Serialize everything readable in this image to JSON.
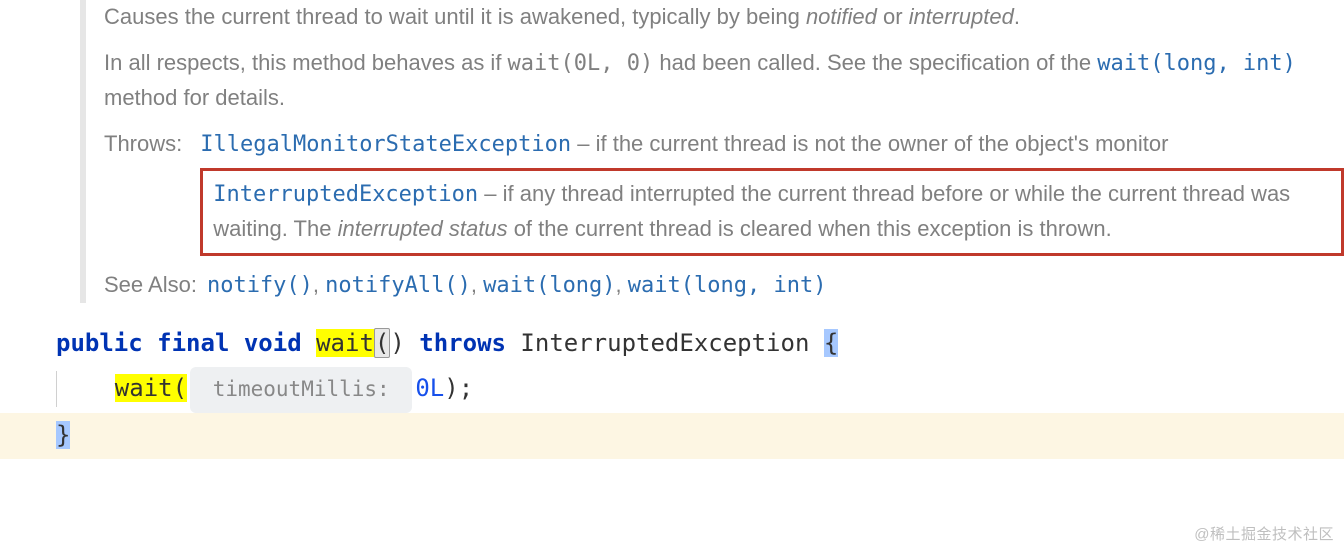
{
  "doc": {
    "para1_prefix": "Causes the current thread to wait until it is awakened, typically by being ",
    "para1_ital1": "notified",
    "para1_mid": " or ",
    "para1_ital2": "interrupted",
    "para1_suffix": ".",
    "para2_prefix": "In all respects, this method behaves as if ",
    "para2_code": "wait(0L, 0)",
    "para2_mid": " had been called. See the specification of the ",
    "para2_link": "wait(long, int)",
    "para2_suffix": " method for details.",
    "throws_label": "Throws:",
    "throws": [
      {
        "exc": "IllegalMonitorStateException",
        "dash": " – ",
        "desc": "if the current thread is not the owner of the object's monitor"
      },
      {
        "exc": "InterruptedException",
        "dash": " – ",
        "desc_prefix": "if any thread interrupted the current thread before or while the current thread was waiting. The ",
        "desc_ital": "interrupted status",
        "desc_suffix": " of the current thread is cleared when this exception is thrown."
      }
    ],
    "seealso_label": "See Also:",
    "seealso": [
      "notify()",
      "notifyAll()",
      "wait(long)",
      "wait(long, int)"
    ],
    "seealso_sep": ", "
  },
  "code": {
    "kw_public": "public",
    "kw_final": "final",
    "kw_void": "void",
    "method": "wait",
    "paren1": "(",
    "paren2": ")",
    "kw_throws": "throws",
    "exc": "InterruptedException",
    "brace_open": "{",
    "call": "wait(",
    "hint": " timeoutMillis: ",
    "arg": "0L",
    "call_close": ");",
    "brace_close": "}"
  },
  "watermark": "@稀土掘金技术社区"
}
